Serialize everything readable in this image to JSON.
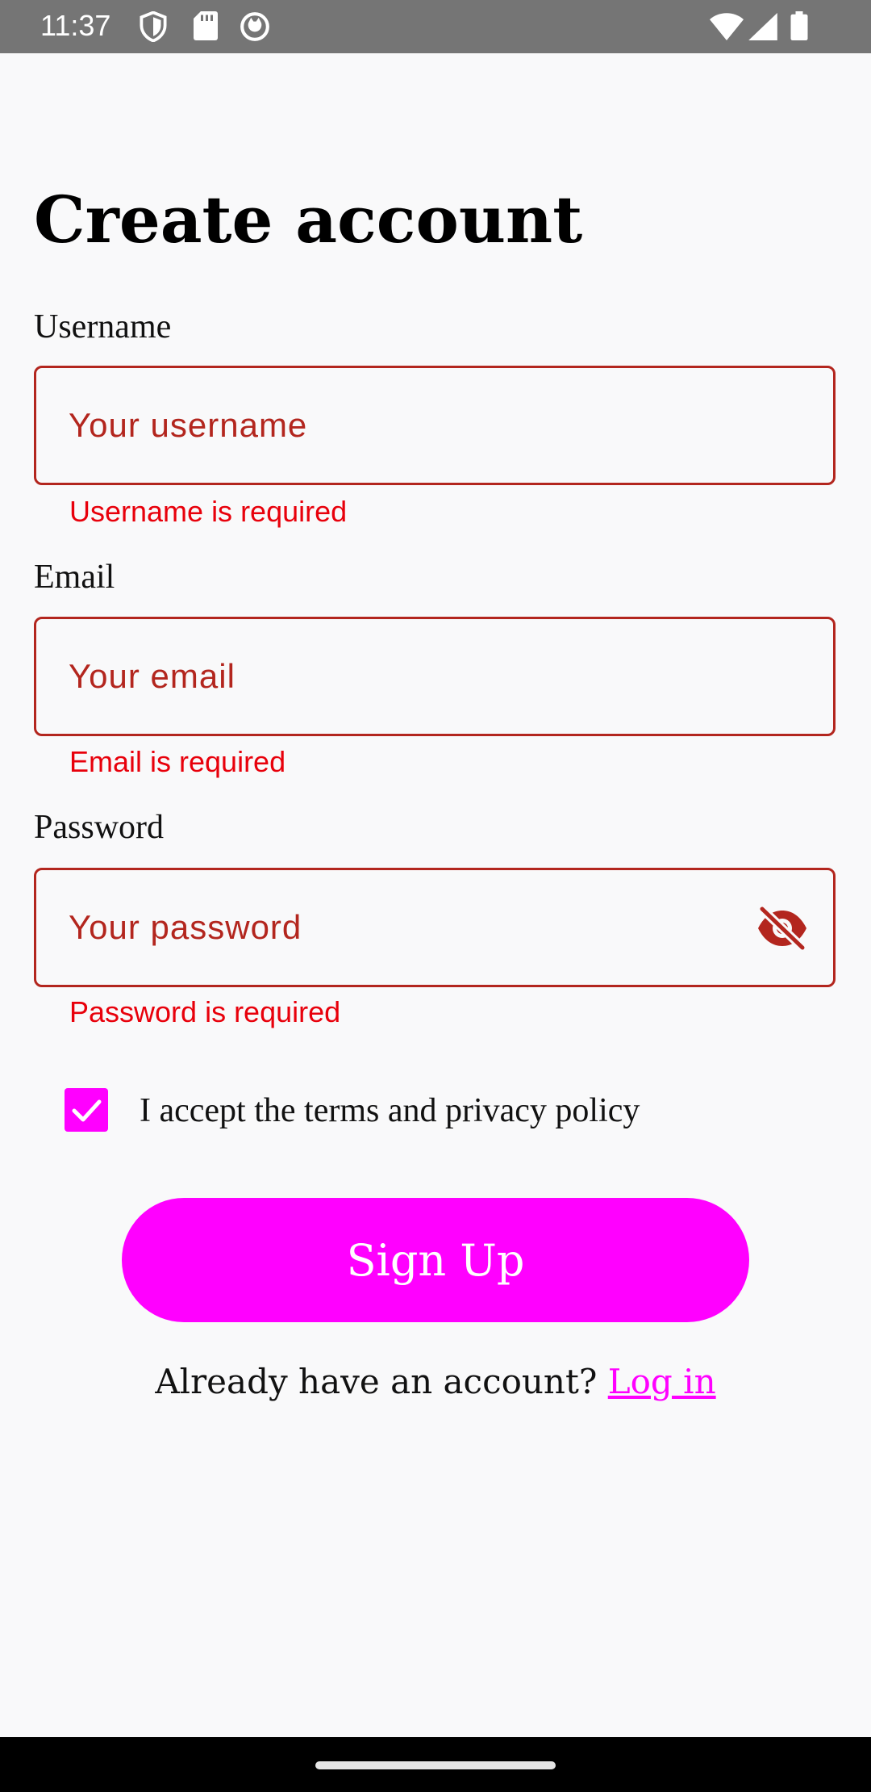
{
  "status_bar": {
    "time": "11:37",
    "icons": [
      "shield-icon",
      "sd-card-icon",
      "app-notification-icon",
      "wifi-icon",
      "cell-signal-icon",
      "battery-icon"
    ]
  },
  "form": {
    "title": "Create account",
    "username": {
      "label": "Username",
      "placeholder": "Your username",
      "value": "",
      "error": "Username is required"
    },
    "email": {
      "label": "Email",
      "placeholder": "Your email",
      "value": "",
      "error": "Email is required"
    },
    "password": {
      "label": "Password",
      "placeholder": "Your password",
      "value": "",
      "error": "Password is required",
      "visibility_icon": "eye-off-icon"
    },
    "terms": {
      "label": "I accept the terms and privacy policy",
      "checked": true
    },
    "signup_label": "Sign Up",
    "login_prompt": "Already have an account?",
    "login_link": "Log in"
  },
  "colors": {
    "accent": "#ff00ff",
    "error": "#e8000b",
    "field_border": "#b3261e",
    "status_bar": "#757575",
    "background": "#f9f9fa"
  }
}
